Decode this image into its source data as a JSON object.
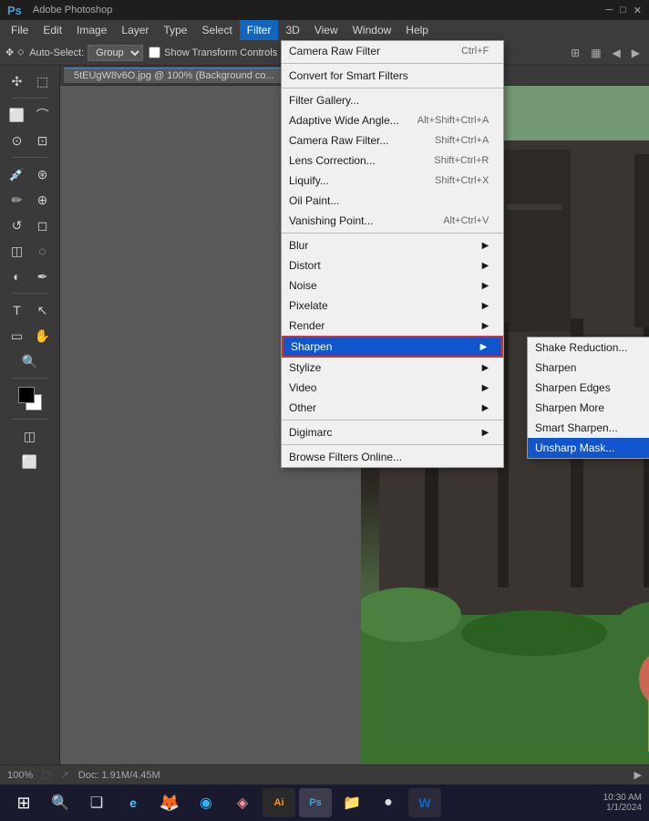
{
  "app": {
    "logo": "Ps",
    "title": "Adobe Photoshop",
    "doc_tab": "5tEUgW8v6O.jpg @ 100% (Background co..."
  },
  "menu_bar": {
    "items": [
      {
        "label": "File",
        "active": false
      },
      {
        "label": "Edit",
        "active": false
      },
      {
        "label": "Image",
        "active": false
      },
      {
        "label": "Layer",
        "active": false
      },
      {
        "label": "Type",
        "active": false
      },
      {
        "label": "Select",
        "active": false
      },
      {
        "label": "Filter",
        "active": true
      },
      {
        "label": "3D",
        "active": false
      },
      {
        "label": "View",
        "active": false
      },
      {
        "label": "Window",
        "active": false
      },
      {
        "label": "Help",
        "active": false
      }
    ]
  },
  "options_bar": {
    "auto_select_label": "Auto-Select:",
    "auto_select_value": "Group",
    "show_transform_label": "Show Transform Controls"
  },
  "filter_menu": {
    "items": [
      {
        "label": "Camera Raw Filter",
        "shortcut": "Ctrl+F",
        "divider_after": true
      },
      {
        "label": "Convert for Smart Filters",
        "shortcut": "",
        "divider_after": true
      },
      {
        "label": "Filter Gallery...",
        "shortcut": ""
      },
      {
        "label": "Adaptive Wide Angle...",
        "shortcut": "Alt+Shift+Ctrl+A"
      },
      {
        "label": "Camera Raw Filter...",
        "shortcut": "Shift+Ctrl+A"
      },
      {
        "label": "Lens Correction...",
        "shortcut": "Shift+Ctrl+R"
      },
      {
        "label": "Liquify...",
        "shortcut": "Shift+Ctrl+X"
      },
      {
        "label": "Oil Paint...",
        "shortcut": ""
      },
      {
        "label": "Vanishing Point...",
        "shortcut": "Alt+Ctrl+V",
        "divider_after": true
      },
      {
        "label": "Blur",
        "arrow": true
      },
      {
        "label": "Distort",
        "arrow": true
      },
      {
        "label": "Noise",
        "arrow": true
      },
      {
        "label": "Pixelate",
        "arrow": true
      },
      {
        "label": "Render",
        "arrow": true
      },
      {
        "label": "Sharpen",
        "arrow": true,
        "highlighted": true
      },
      {
        "label": "Stylize",
        "arrow": true
      },
      {
        "label": "Video",
        "arrow": true
      },
      {
        "label": "Other",
        "arrow": true,
        "divider_after": true
      },
      {
        "label": "Digimarc",
        "arrow": true,
        "divider_after": true
      },
      {
        "label": "Browse Filters Online...",
        "shortcut": ""
      }
    ]
  },
  "sharpen_submenu": {
    "items": [
      {
        "label": "Shake Reduction...",
        "shortcut": ""
      },
      {
        "label": "Sharpen",
        "shortcut": ""
      },
      {
        "label": "Sharpen Edges",
        "shortcut": ""
      },
      {
        "label": "Sharpen More",
        "shortcut": ""
      },
      {
        "label": "Smart Sharpen...",
        "shortcut": ""
      },
      {
        "label": "Unsharp Mask...",
        "shortcut": "",
        "highlighted": true
      }
    ]
  },
  "status_bar": {
    "zoom": "100%",
    "doc_info": "Doc: 1.91M/4.45M"
  },
  "taskbar": {
    "start_icon": "⊞",
    "search_icon": "🔍",
    "task_view_icon": "❑",
    "apps": [
      {
        "name": "Edge",
        "icon": "e"
      },
      {
        "name": "Firefox",
        "icon": "🦊"
      },
      {
        "name": "App1",
        "icon": "◉"
      },
      {
        "name": "App2",
        "icon": "◈"
      },
      {
        "name": "Illustrator",
        "icon": "Ai"
      },
      {
        "name": "Photoshop",
        "icon": "Ps"
      },
      {
        "name": "Explorer",
        "icon": "📁"
      },
      {
        "name": "Chrome",
        "icon": "●"
      },
      {
        "name": "Word",
        "icon": "W"
      }
    ]
  }
}
